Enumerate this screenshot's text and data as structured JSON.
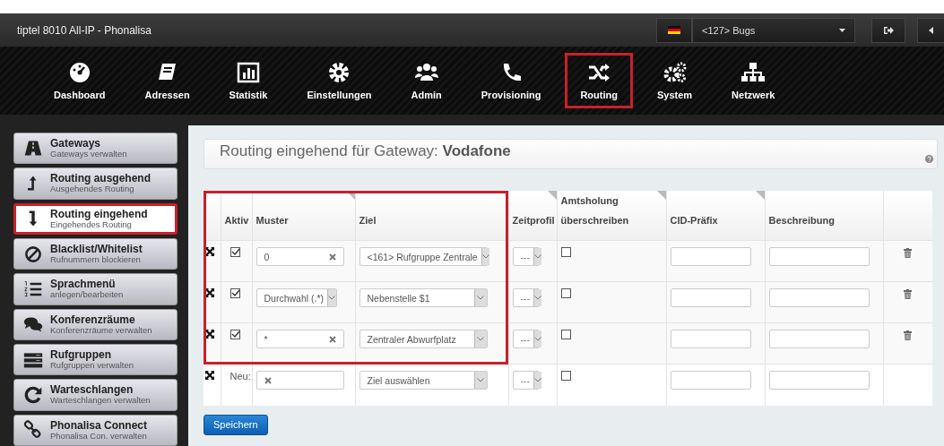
{
  "window": {
    "title": "tiptel 8010 All-IP - Phonalisa"
  },
  "header": {
    "account": "<127> Bugs"
  },
  "nav": [
    {
      "label": "Dashboard",
      "highlighted": false
    },
    {
      "label": "Adressen",
      "highlighted": false
    },
    {
      "label": "Statistik",
      "highlighted": false
    },
    {
      "label": "Einstellungen",
      "highlighted": false
    },
    {
      "label": "Admin",
      "highlighted": false
    },
    {
      "label": "Provisioning",
      "highlighted": false
    },
    {
      "label": "Routing",
      "highlighted": true
    },
    {
      "label": "System",
      "highlighted": false
    },
    {
      "label": "Netzwerk",
      "highlighted": false
    }
  ],
  "sidebar": {
    "items": [
      {
        "title": "Gateways",
        "subtitle": "Gateways verwalten",
        "selected": false
      },
      {
        "title": "Routing ausgehend",
        "subtitle": "Ausgehendes Routing",
        "selected": false
      },
      {
        "title": "Routing eingehend",
        "subtitle": "Eingehendes Routing",
        "selected": true
      },
      {
        "title": "Blacklist/Whitelist",
        "subtitle": "Rufnummern blockieren",
        "selected": false
      },
      {
        "title": "Sprachmenü",
        "subtitle": "anlegen/bearbeiten",
        "selected": false
      },
      {
        "title": "Konferenzräume",
        "subtitle": "Konferenzräume verwalten",
        "selected": false
      },
      {
        "title": "Rufgruppen",
        "subtitle": "Rufgruppen verwalten",
        "selected": false
      },
      {
        "title": "Warteschlangen",
        "subtitle": "Warteschlangen verwalten",
        "selected": false
      },
      {
        "title": "Phonalisa Connect",
        "subtitle": "Phonalisa Con. verwalten",
        "selected": false
      }
    ]
  },
  "heading": "Routing eingehend für Gateway:  **Vodafone**",
  "table": {
    "highlight_frame": true,
    "columns": [
      {
        "label": "Aktiv",
        "corner_tab": false
      },
      {
        "label": "Muster",
        "corner_tab": true
      },
      {
        "label": "Ziel",
        "corner_tab": false
      },
      {
        "label": "Zeitprofil",
        "corner_tab": true
      },
      {
        "label": "Amtsholung überschreiben",
        "corner_tab": true
      },
      {
        "label": "CID-Präfix",
        "corner_tab": true
      },
      {
        "label": "Beschreibung",
        "corner_tab": false
      }
    ],
    "rows": [
      {
        "kind": "entry",
        "active": true,
        "pattern": {
          "kind": "text",
          "value": "0"
        },
        "target": "<161> Rufgruppe Zentrale",
        "time_profile": "---",
        "override": false
      },
      {
        "kind": "entry",
        "active": true,
        "pattern": {
          "kind": "select",
          "value": "Durchwahl (.*)"
        },
        "target": "Nebenstelle $1",
        "time_profile": "---",
        "override": false
      },
      {
        "kind": "entry",
        "active": true,
        "pattern": {
          "kind": "text",
          "value": "*"
        },
        "target": "Zentraler Abwurfplatz",
        "time_profile": "---",
        "override": false
      },
      {
        "kind": "new",
        "label": "Neu:",
        "pattern": {
          "kind": "text"
        },
        "target": "Ziel auswählen",
        "time_profile": "---",
        "override": false
      }
    ]
  },
  "save_button": "Speichern"
}
